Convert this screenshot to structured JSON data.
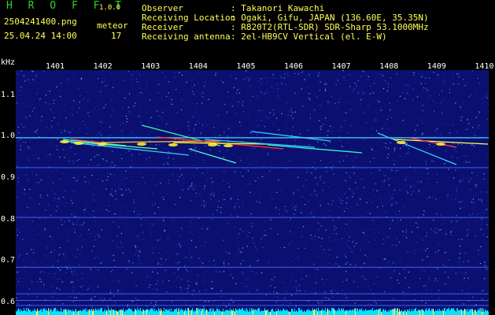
{
  "header": {
    "app_name": "H R O F F T",
    "version": "1.0.0",
    "filename": "2504241400.png",
    "datetime": "25.04.24 14:00",
    "meteor_label": "meteor",
    "meteor_count": "17",
    "fields": [
      {
        "label": "Observer",
        "value": ": Takanori Kawachi"
      },
      {
        "label": "Receiving Location",
        "value": ": Ogaki, Gifu, JAPAN (136.60E, 35.35N)"
      },
      {
        "label": "Receiver",
        "value": ": R820T2(RTL-SDR) SDR-Sharp 53.1000MHz"
      },
      {
        "label": "Receiving antenna",
        "value": ": 2el-HB9CV Vertical (el. E-W)"
      }
    ]
  },
  "colors": {
    "background": "#000000",
    "logo": "#2bd52b",
    "labels": "#ffff55",
    "values": "#ffffff",
    "noise": "#1a1fa6",
    "signal": "#ffff33",
    "baseline": "#00ffff"
  },
  "chart_data": {
    "type": "heatmap",
    "ylabel": "kHz",
    "x_ticks": [
      "1401",
      "1402",
      "1403",
      "1404",
      "1405",
      "1406",
      "1407",
      "1408",
      "1409",
      "1410"
    ],
    "y_ticks": [
      "1.1",
      "1.0",
      "0.9",
      "0.8",
      "0.7",
      "0.6"
    ],
    "ylim": [
      0.57,
      1.16
    ],
    "grid": false
  }
}
